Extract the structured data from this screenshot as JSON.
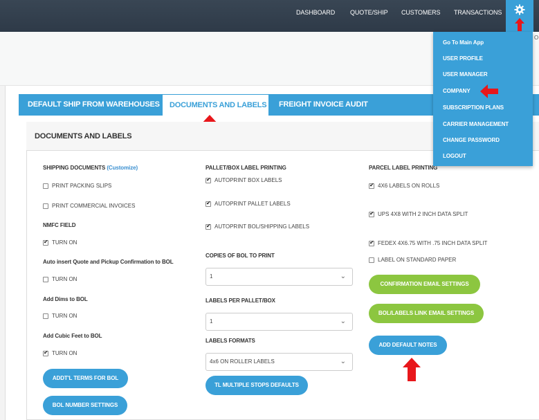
{
  "topnav": {
    "dashboard": "DASHBOARD",
    "quote_ship": "QUOTE/SHIP",
    "customers": "CUSTOMERS",
    "transactions": "TRANSACTIONS"
  },
  "edge_text": "O",
  "settings_menu": {
    "items": [
      "Go To Main App",
      "USER PROFILE",
      "USER MANAGER",
      "COMPANY",
      "SUBSCRIPTION PLANS",
      "CARRIER MANAGEMENT",
      "CHANGE PASSWORD",
      "LOGOUT"
    ]
  },
  "tabs": [
    "DEFAULT SHIP FROM WAREHOUSES",
    "DOCUMENTS AND LABELS",
    "FREIGHT INVOICE AUDIT"
  ],
  "active_tab": "DOCUMENTS AND LABELS",
  "panel": {
    "title": "DOCUMENTS AND LABELS"
  },
  "col1": {
    "shipping_docs": "SHIPPING DOCUMENTS",
    "customize": "(Customize)",
    "print_packing": "PRINT PACKING SLIPS",
    "print_commercial": "PRINT COMMERCIAL INVOICES",
    "nmfc": "NMFC FIELD",
    "nmfc_on": "TURN ON",
    "auto_insert": "Auto insert Quote and Pickup Confirmation to BOL",
    "auto_insert_on": "TURN ON",
    "add_dims": "Add Dims to BOL",
    "add_dims_on": "TURN ON",
    "add_cubic": "Add Cubic Feet to BOL",
    "add_cubic_on": "TURN ON",
    "addtl_terms_btn": "ADDT'L TERMS FOR BOL",
    "bol_number_btn": "BOL NUMBER SETTINGS"
  },
  "col2": {
    "pallet_box": "PALLET/BOX LABEL PRINTING",
    "autoprint_box": "AUTOPRINT BOX LABELS",
    "autoprint_pallet": "AUTOPRINT PALLET LABELS",
    "autoprint_bol": "AUTOPRINT BOL/SHIPPING LABELS",
    "copies_label": "COPIES OF BOL TO PRINT",
    "copies_value": "1",
    "labels_per_label": "LABELS PER PALLET/BOX",
    "labels_per_value": "1",
    "formats_label": "LABELS FORMATS",
    "formats_value": "4x6 ON ROLLER LABELS",
    "tl_multiple_btn": "TL MULTIPLE STOPS DEFAULTS"
  },
  "col3": {
    "parcel": "PARCEL LABEL PRINTING",
    "rolls": "4X6 LABELS ON ROLLS",
    "ups": "UPS 4X8 WITH 2 INCH DATA SPLIT",
    "fedex": "FEDEX 4X6.75 WITH .75 INCH DATA SPLIT",
    "standard": "LABEL ON STANDARD PAPER",
    "confirmation_btn": "CONFIRMATION EMAIL SETTINGS",
    "bol_link_btn": "BOL/LABELS LINK EMAIL SETTINGS",
    "default_notes_btn": "ADD DEFAULT NOTES"
  },
  "checkbox_states": {
    "print_packing": false,
    "print_commercial": false,
    "nmfc_on": true,
    "auto_insert_on": false,
    "add_dims_on": false,
    "add_cubic_on": true,
    "autoprint_box": true,
    "autoprint_pallet": true,
    "autoprint_bol": true,
    "rolls": true,
    "ups": true,
    "fedex": true,
    "standard": false
  },
  "colors": {
    "topbar": "#394654",
    "accent_blue": "#3aa0d8",
    "accent_green": "#8cc640",
    "annotation_red": "#e8171b"
  },
  "icons": {
    "settings": "gear-icon",
    "select_caret": "chevron-down-icon",
    "annotation": "red-arrow-icon"
  }
}
